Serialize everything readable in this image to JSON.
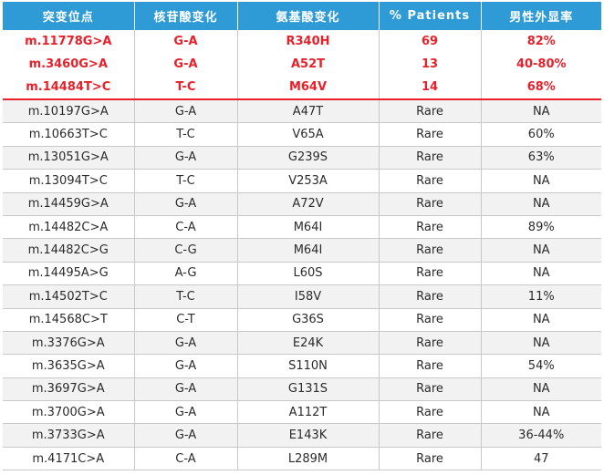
{
  "table": {
    "headers": [
      "突变位点",
      "核苷酸变化",
      "氨基酸变化",
      "% Patients",
      "男性外显率"
    ],
    "highlighted_rows": [
      [
        "m.11778G>A",
        "G-A",
        "R340H",
        "69",
        "82%"
      ],
      [
        "m.3460G>A",
        "G-A",
        "A52T",
        "13",
        "40-80%"
      ],
      [
        "m.14484T>C",
        "T-C",
        "M64V",
        "14",
        "68%"
      ]
    ],
    "rows": [
      [
        "m.10197G>A",
        "G-A",
        "A47T",
        "Rare",
        "NA"
      ],
      [
        "m.10663T>C",
        "T-C",
        "V65A",
        "Rare",
        "60%"
      ],
      [
        "m.13051G>A",
        "G-A",
        "G239S",
        "Rare",
        "63%"
      ],
      [
        "m.13094T>C",
        "T-C",
        "V253A",
        "Rare",
        "NA"
      ],
      [
        "m.14459G>A",
        "G-A",
        "A72V",
        "Rare",
        "NA"
      ],
      [
        "m.14482C>A",
        "C-A",
        "M64I",
        "Rare",
        "89%"
      ],
      [
        "m.14482C>G",
        "C-G",
        "M64I",
        "Rare",
        "NA"
      ],
      [
        "m.14495A>G",
        "A-G",
        "L60S",
        "Rare",
        "NA"
      ],
      [
        "m.14502T>C",
        "T-C",
        "I58V",
        "Rare",
        "11%"
      ],
      [
        "m.14568C>T",
        "C-T",
        "G36S",
        "Rare",
        "NA"
      ],
      [
        "m.3376G>A",
        "G-A",
        "E24K",
        "Rare",
        "NA"
      ],
      [
        "m.3635G>A",
        "G-A",
        "S110N",
        "Rare",
        "54%"
      ],
      [
        "m.3697G>A",
        "G-A",
        "G131S",
        "Rare",
        "NA"
      ],
      [
        "m.3700G>A",
        "G-A",
        "A112T",
        "Rare",
        "NA"
      ],
      [
        "m.3733G>A",
        "G-A",
        "E143K",
        "Rare",
        "36-44%"
      ],
      [
        "m.4171C>A",
        "C-A",
        "L289M",
        "Rare",
        "47"
      ]
    ]
  },
  "colors": {
    "header_bg": "#2e9bd6",
    "highlight_text": "#e8202a",
    "stripe": "#f2f2f2"
  }
}
